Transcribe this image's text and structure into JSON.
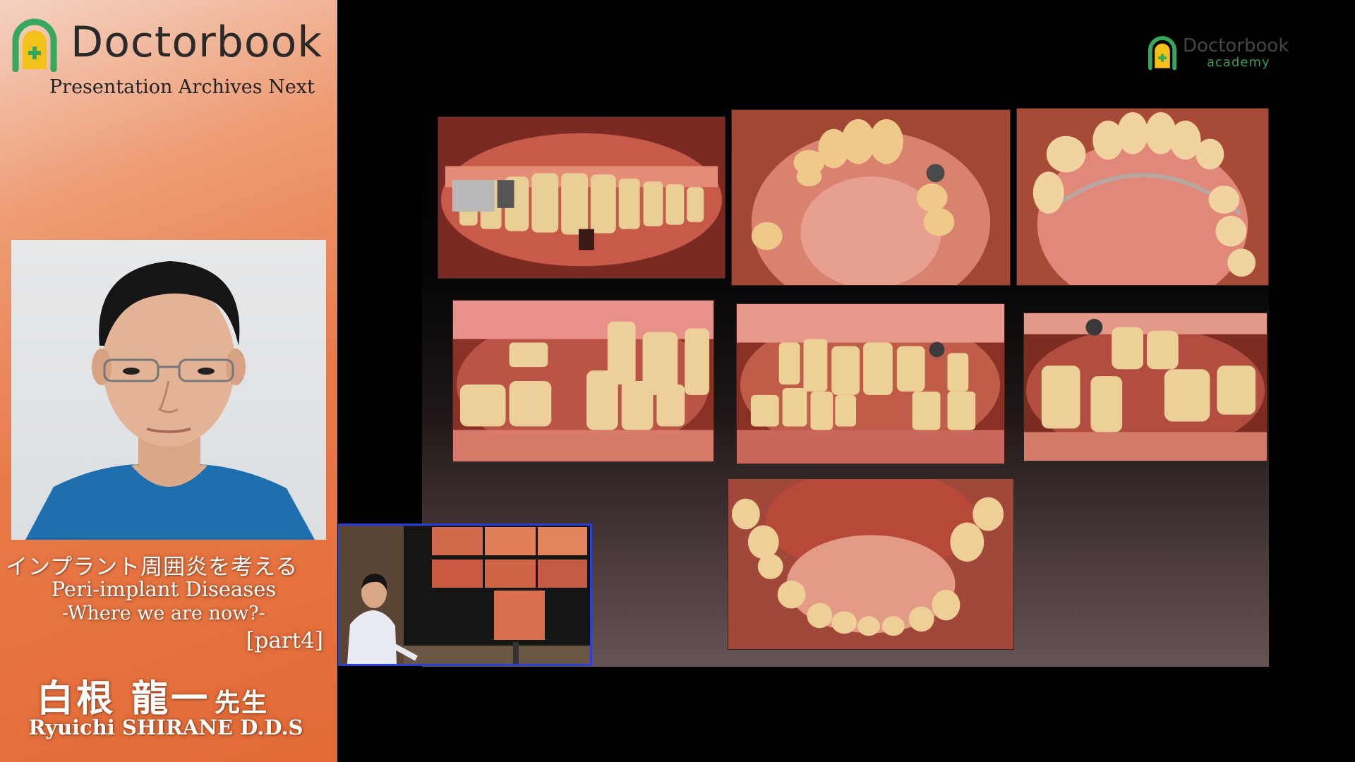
{
  "brand": {
    "name": "Doctorbook",
    "tagline": "Presentation Archives Next",
    "accent_green": "#36a85e",
    "accent_yellow": "#f4c01a"
  },
  "lecture": {
    "title_jp": "インプラント周囲炎を考える",
    "title_en_line1": "Peri-implant Diseases",
    "title_en_line2": "-Where we are now?-",
    "part": "[part4]"
  },
  "speaker": {
    "name_jp": "白根 龍一",
    "honorific_jp": "先生",
    "name_en": "Ryuichi SHIRANE D.D.S"
  },
  "academy": {
    "name_line1": "Doctorbook",
    "name_line2": "academy"
  },
  "colors": {
    "panel_orange": "#e26a35",
    "pip_border": "#2a3fd6"
  }
}
